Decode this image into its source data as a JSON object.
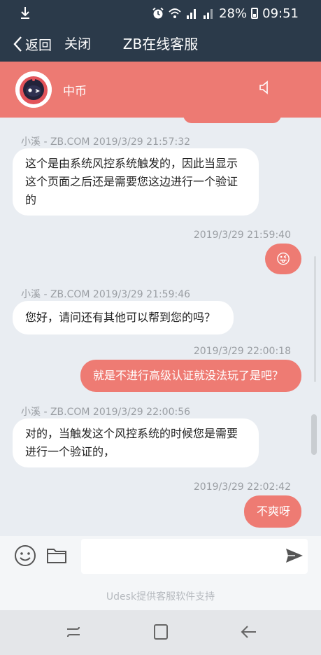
{
  "status_bar": {
    "battery": "28%",
    "time": "09:51",
    "icons": [
      "download-icon",
      "alarm-icon",
      "wifi-icon",
      "signal-1-icon",
      "signal-2-icon",
      "battery-icon"
    ]
  },
  "nav": {
    "back_label": "返回",
    "close_label": "关闭",
    "title": "ZB在线客服"
  },
  "agent": {
    "name": "中币",
    "speaker_icon": "speaker-icon"
  },
  "messages": [
    {
      "side": "left",
      "meta": "小溪 - ZB.COM   2019/3/29 21:57:32",
      "text": "这个是由系统风控系统触发的，因此当显示这个页面之后还是需要您这边进行一个验证的"
    },
    {
      "side": "right",
      "meta": "2019/3/29 21:59:40",
      "text": "😜"
    },
    {
      "side": "left",
      "meta": "小溪 - ZB.COM   2019/3/29 21:59:46",
      "text": "您好，请问还有其他可以帮到您的吗？"
    },
    {
      "side": "right",
      "meta": "2019/3/29 22:00:18",
      "text": "就是不进行高级认证就没法玩了是吧？"
    },
    {
      "side": "left",
      "meta": "小溪 - ZB.COM   2019/3/29 22:00:56",
      "text": "对的，当触发这个风控系统的时候您是需要进行一个验证的，"
    },
    {
      "side": "right",
      "meta": "2019/3/29 22:02:42",
      "text": "不爽呀"
    }
  ],
  "input": {
    "placeholder": "",
    "value": ""
  },
  "footer": {
    "powered_by": "Udesk提供客服软件支持"
  },
  "colors": {
    "header_dark": "#2b3a4a",
    "accent": "#ed7a73",
    "chat_bg": "#e9edf2"
  }
}
